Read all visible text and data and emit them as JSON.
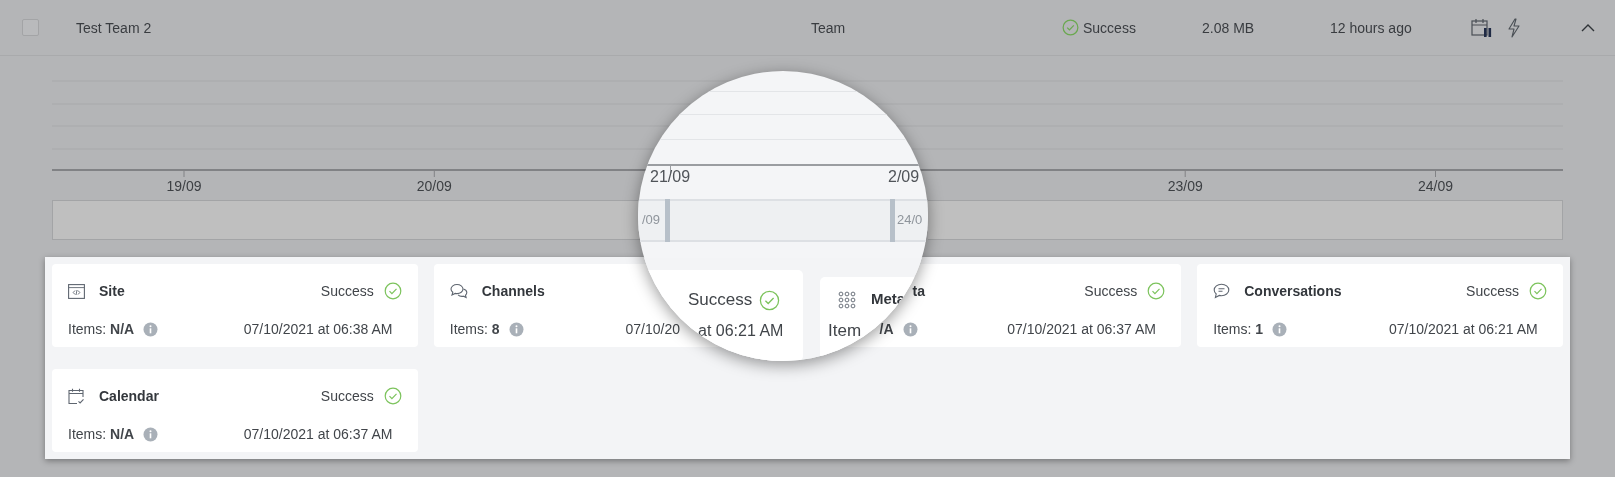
{
  "row": {
    "checked": false,
    "name": "Test Team 2",
    "type": "Team",
    "status": "Success",
    "size": "2.08 MB",
    "last_backup": "12 hours ago",
    "expanded": true
  },
  "timeline": {
    "axis_labels_left": [
      "19/09",
      "20/09"
    ],
    "axis_labels_right": [
      "23/09",
      "24/09"
    ]
  },
  "magnifier": {
    "axis_label": "21/09",
    "next_axis_label": "2/09",
    "range_start": "/09",
    "range_end": "24/0",
    "status": "Success",
    "date": "at 06:21 AM",
    "title": "Meta",
    "items": "Item"
  },
  "cards": [
    {
      "kind": "site",
      "title": "Site",
      "status": "Success",
      "items": "Items: **N/A**",
      "info": true,
      "date": "07/10/2021 at 06:38 AM"
    },
    {
      "kind": "channels",
      "title": "Channels",
      "items": "Items: **8**",
      "info": true,
      "date": "07/10/20"
    },
    {
      "kind": "metadata",
      "title": "ta",
      "status": "Success",
      "items": "**/A**",
      "info": true,
      "date": "07/10/2021 at 06:37 AM"
    },
    {
      "kind": "conversations",
      "title": "Conversations",
      "status": "Success",
      "items": "Items: **1**",
      "info": true,
      "date": "07/10/2021 at 06:21 AM"
    },
    {
      "kind": "calendar",
      "title": "Calendar",
      "status": "Success",
      "items": "Items: **N/A**",
      "info": true,
      "date": "07/10/2021 at 06:37 AM"
    }
  ]
}
